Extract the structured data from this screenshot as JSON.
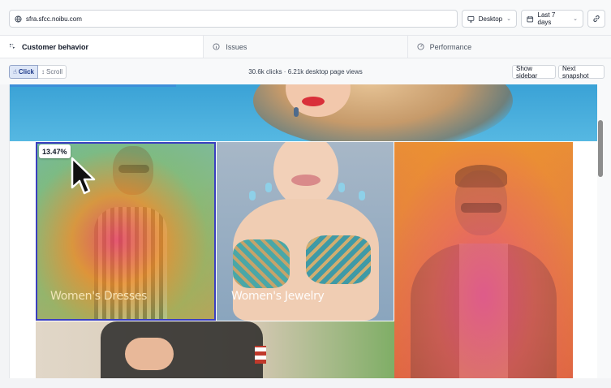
{
  "topbar": {
    "url": "sfra.sfcc.noibu.com",
    "device": "Desktop",
    "date_range": "Last 7 days"
  },
  "tabs": [
    {
      "label": "Customer behavior",
      "active": true
    },
    {
      "label": "Issues",
      "active": false
    },
    {
      "label": "Performance",
      "active": false
    }
  ],
  "toolbar": {
    "click_label": "Click",
    "scroll_label": "Scroll",
    "stats": "30.6k clicks · 6.21k desktop page views",
    "show_sidebar": "Show sidebar",
    "next_snapshot": "Next snapshot"
  },
  "heatmap": {
    "selected_percentage": "13.47%",
    "tiles": [
      {
        "label": "Women's Dresses"
      },
      {
        "label": "Women's Jewelry"
      }
    ]
  },
  "icons": {
    "globe": "globe-icon",
    "monitor": "monitor-icon",
    "calendar": "calendar-icon",
    "link": "link-icon",
    "behavior": "behavior-icon",
    "issues": "info-circle-icon",
    "performance": "gauge-icon",
    "click": "hand-pointer-icon",
    "scroll": "scroll-arrows-icon",
    "cursor": "cursor-arrow-icon"
  },
  "colors": {
    "accent": "#3a3fbf",
    "progress": "#3d8ed8",
    "active_mode_bg": "#dde6f7"
  }
}
